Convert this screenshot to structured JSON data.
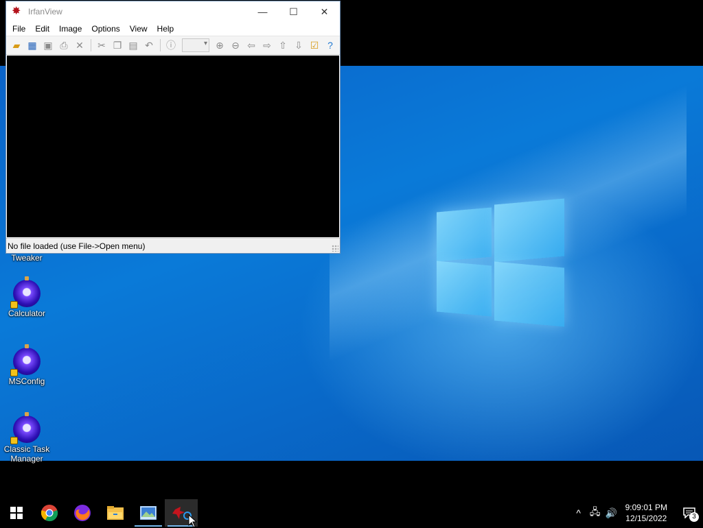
{
  "window": {
    "title": "IrfanView",
    "minimize_glyph": "—",
    "maximize_glyph": "☐",
    "close_glyph": "✕",
    "menu": [
      "File",
      "Edit",
      "Image",
      "Options",
      "View",
      "Help"
    ],
    "status": "No file loaded (use File->Open menu)"
  },
  "desktop": {
    "partial_label": "Tweaker",
    "icons": [
      {
        "label_1": "Calculator",
        "label_2": ""
      },
      {
        "label_1": "MSConfig",
        "label_2": ""
      },
      {
        "label_1": "Classic Task",
        "label_2": "Manager"
      }
    ]
  },
  "taskbar": {
    "apps": [
      "start-icon",
      "chrome-icon",
      "firefox-icon",
      "file-explorer-icon",
      "photos-icon",
      "irfanview-icon"
    ],
    "clock": {
      "time": "9:09:01 PM",
      "date": "12/15/2022"
    },
    "notification_count": "3"
  },
  "colors": {
    "wallpaper": "#0a74d4",
    "taskbar": "#000000",
    "accent": "#76b9ed"
  }
}
